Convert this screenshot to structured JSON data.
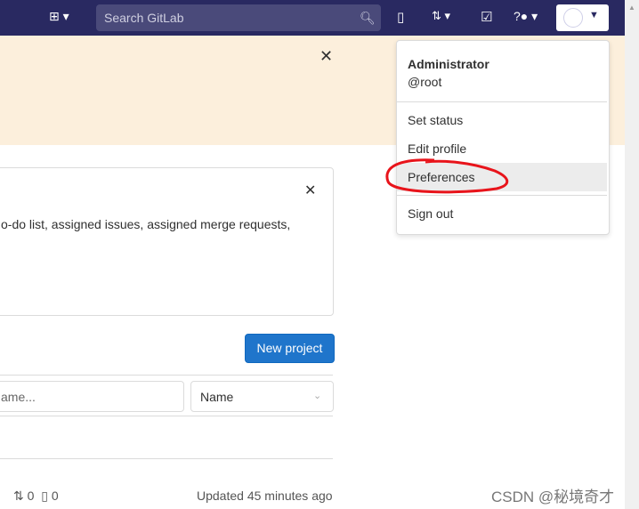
{
  "header": {
    "search_placeholder": "Search GitLab"
  },
  "card": {
    "text": "o-do list, assigned issues, assigned merge requests,"
  },
  "projects": {
    "new_project": "New project",
    "filter_placeholder": "ame...",
    "sort_value": "Name",
    "mr_count": "0",
    "issue_count": "0",
    "updated": "Updated 45 minutes ago"
  },
  "user_menu": {
    "name": "Administrator",
    "username": "@root",
    "items": [
      "Set status",
      "Edit profile",
      "Preferences",
      "Sign out"
    ]
  },
  "watermark": "CSDN @秘境奇才",
  "colors": {
    "header": "#292961",
    "banner": "#fcefdc",
    "primary": "#1f75cb",
    "annotation": "#e8141b"
  }
}
